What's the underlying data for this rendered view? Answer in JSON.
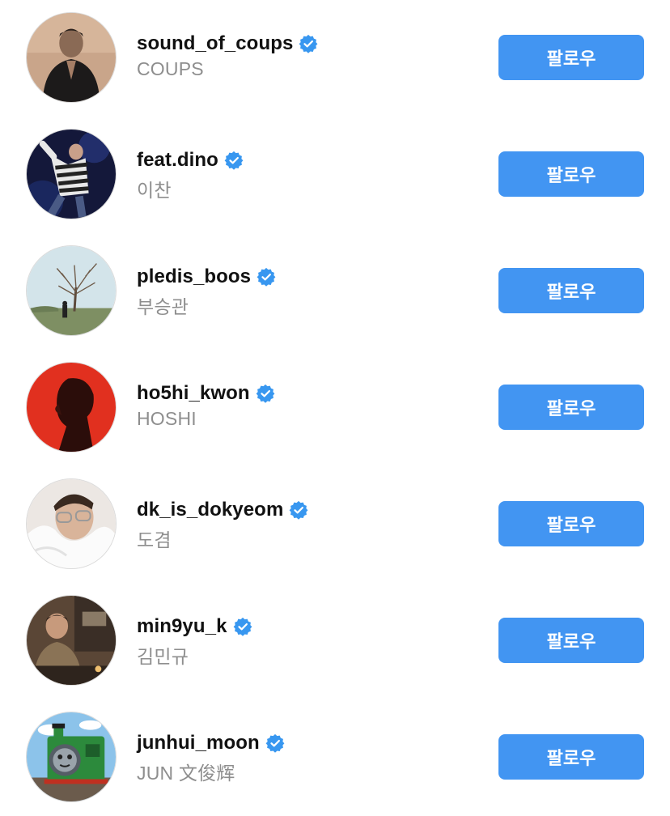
{
  "colors": {
    "accent": "#4295f2",
    "verified": "#3897f0",
    "username": "#111111",
    "fullname": "#8e8e8e"
  },
  "verified_icon": "verified-badge-icon",
  "accounts": [
    {
      "username": "sound_of_coups",
      "full_name": "COUPS",
      "verified": true,
      "follow_label": "팔로우",
      "avatar": "person-in-black-suit"
    },
    {
      "username": "feat.dino",
      "full_name": "이찬",
      "verified": true,
      "follow_label": "팔로우",
      "avatar": "dancer-on-stage"
    },
    {
      "username": "pledis_boos",
      "full_name": "부승관",
      "verified": true,
      "follow_label": "팔로우",
      "avatar": "person-under-bare-tree"
    },
    {
      "username": "ho5hi_kwon",
      "full_name": "HOSHI",
      "verified": true,
      "follow_label": "팔로우",
      "avatar": "silhouette-on-red"
    },
    {
      "username": "dk_is_dokyeom",
      "full_name": "도겸",
      "verified": true,
      "follow_label": "팔로우",
      "avatar": "person-with-glasses-in-white-blanket"
    },
    {
      "username": "min9yu_k",
      "full_name": "김민규",
      "verified": true,
      "follow_label": "팔로우",
      "avatar": "person-in-cafe"
    },
    {
      "username": "junhui_moon",
      "full_name": "JUN 文俊辉",
      "verified": true,
      "follow_label": "팔로우",
      "avatar": "green-cartoon-train"
    }
  ]
}
